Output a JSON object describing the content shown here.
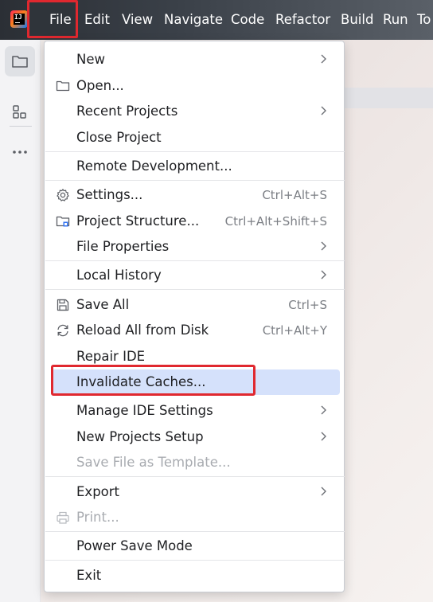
{
  "menubar": {
    "app_logo_text": "IJ",
    "items": [
      "File",
      "Edit",
      "View",
      "Navigate",
      "Code",
      "Refactor",
      "Build",
      "Run",
      "To"
    ]
  },
  "toolstrip": {
    "icons": [
      "folder-icon",
      "structure-icon",
      "more-icon"
    ]
  },
  "file_menu": {
    "new": "New",
    "open": "Open...",
    "recent_projects": "Recent Projects",
    "close_project": "Close Project",
    "remote_development": "Remote Development...",
    "settings": "Settings...",
    "settings_shortcut": "Ctrl+Alt+S",
    "project_structure": "Project Structure...",
    "project_structure_shortcut": "Ctrl+Alt+Shift+S",
    "file_properties": "File Properties",
    "local_history": "Local History",
    "save_all": "Save All",
    "save_all_shortcut": "Ctrl+S",
    "reload_all": "Reload All from Disk",
    "reload_all_shortcut": "Ctrl+Alt+Y",
    "repair_ide": "Repair IDE",
    "invalidate_caches": "Invalidate Caches...",
    "manage_ide_settings": "Manage IDE Settings",
    "new_projects_setup": "New Projects Setup",
    "save_file_as_template": "Save File as Template...",
    "export": "Export",
    "print": "Print...",
    "power_save_mode": "Power Save Mode",
    "exit": "Exit"
  },
  "colors": {
    "highlight_border": "#e0282f",
    "selected_row": "#d5e1fb"
  }
}
